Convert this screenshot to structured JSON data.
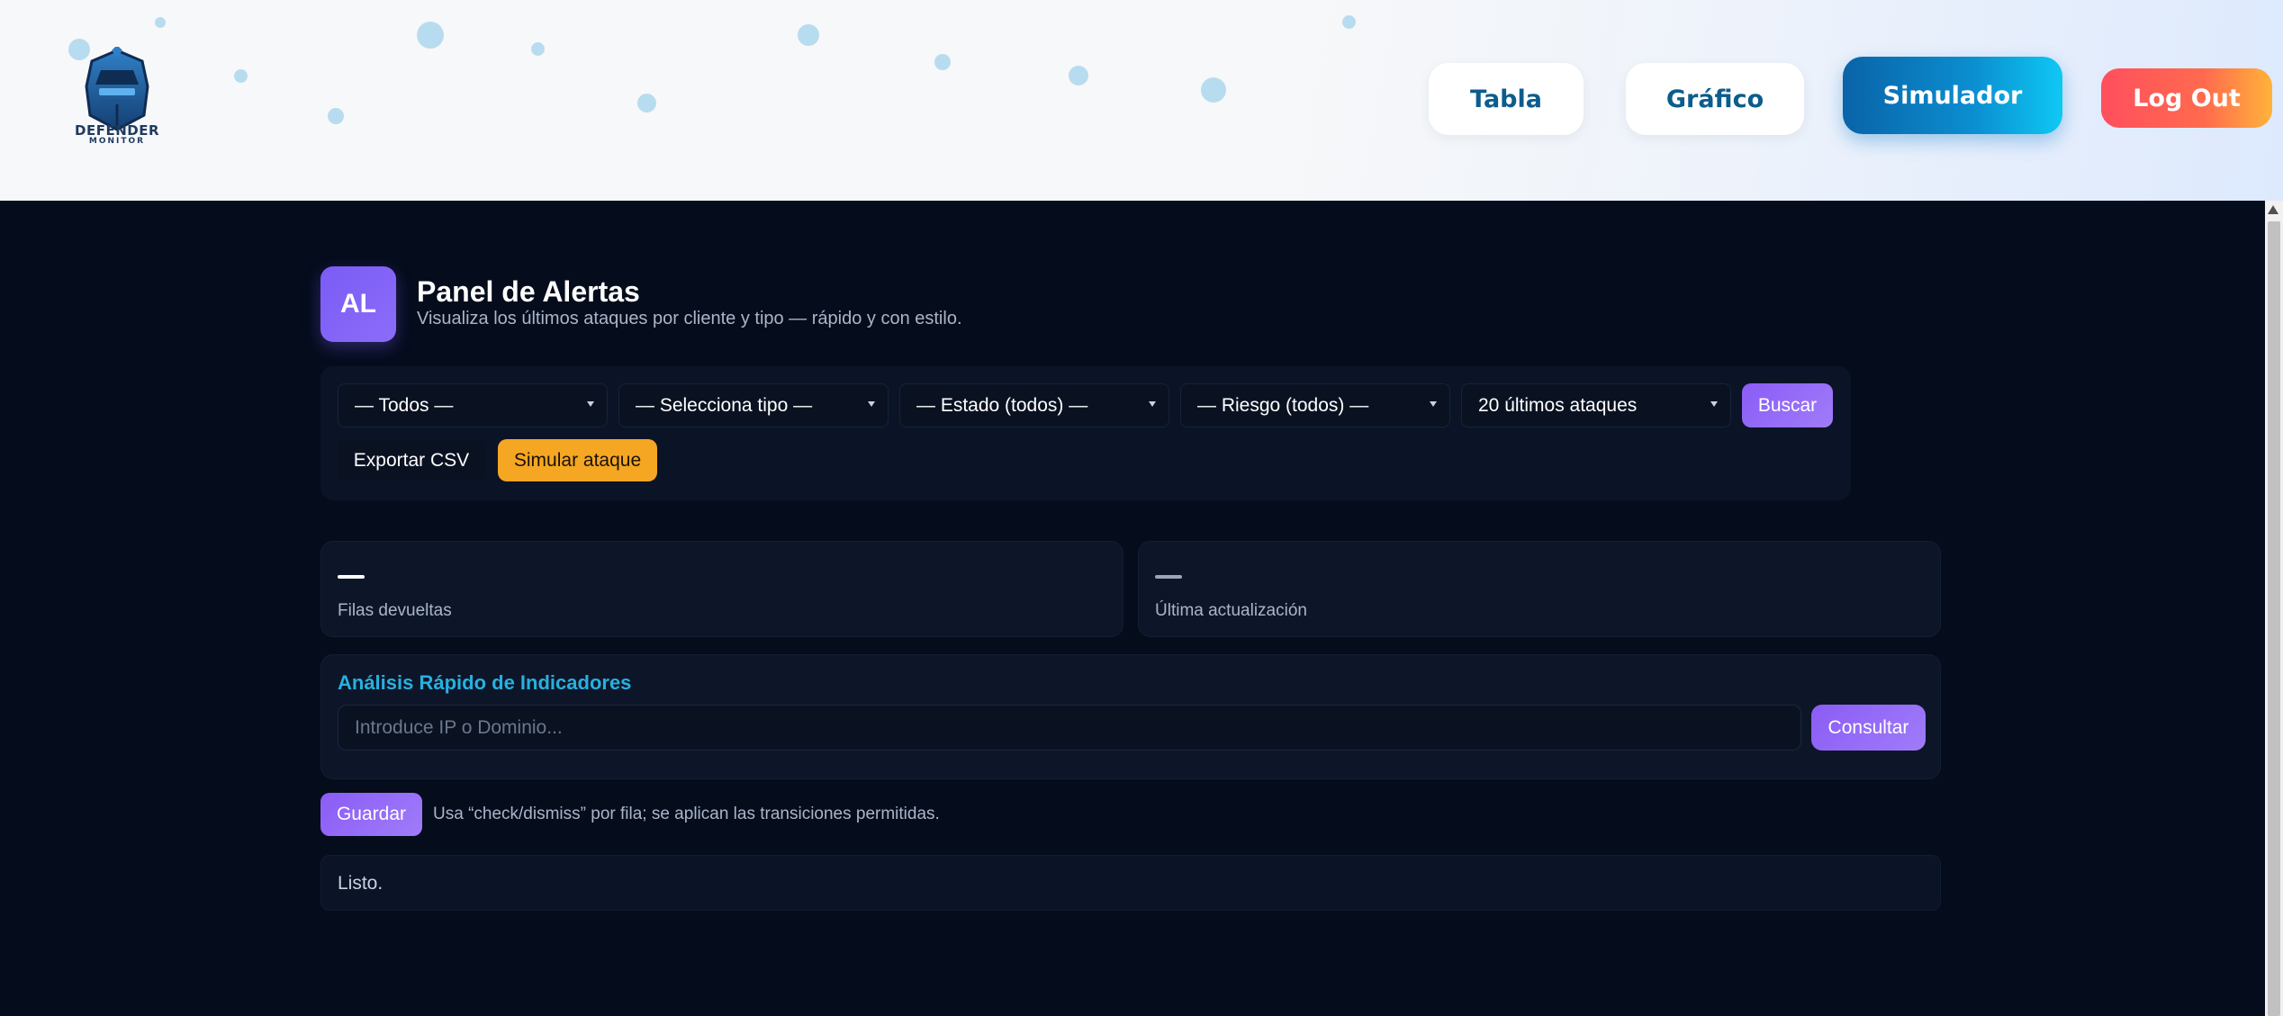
{
  "logo": {
    "name": "DEFENDER",
    "sub": "MONITOR"
  },
  "nav": {
    "tabla": "Tabla",
    "grafico": "Gráfico",
    "simulador": "Simulador",
    "logout": "Log Out"
  },
  "panel": {
    "badge": "AL",
    "title": "Panel de Alertas",
    "subtitle": "Visualiza los últimos ataques por cliente y tipo — rápido y con estilo."
  },
  "filters": {
    "cliente": "— Todos —",
    "tipo": "— Selecciona tipo —",
    "estado": "— Estado (todos) —",
    "riesgo": "— Riesgo (todos) —",
    "limite": "20 últimos ataques",
    "buscar": "Buscar",
    "exportar": "Exportar CSV",
    "simular": "Simular ataque"
  },
  "stats": [
    {
      "label": "Filas devueltas"
    },
    {
      "label": "Última actualización"
    }
  ],
  "analysis": {
    "title": "Análisis Rápido de Indicadores",
    "placeholder": "Introduce IP o Dominio...",
    "consultar": "Consultar"
  },
  "actions": {
    "guardar": "Guardar",
    "hint": "Usa “check/dismiss” por fila; se aplican las transiciones permitidas."
  },
  "status": "Listo.",
  "colors": {
    "background": "#050c1c",
    "accent_purple": "#8b5cf6",
    "accent_cyan": "#27b0e0",
    "warning": "#f5a623",
    "logout_red": "#ff4f5e"
  },
  "icons": [
    "knight-helmet-logo",
    "chevron-down-icon"
  ]
}
